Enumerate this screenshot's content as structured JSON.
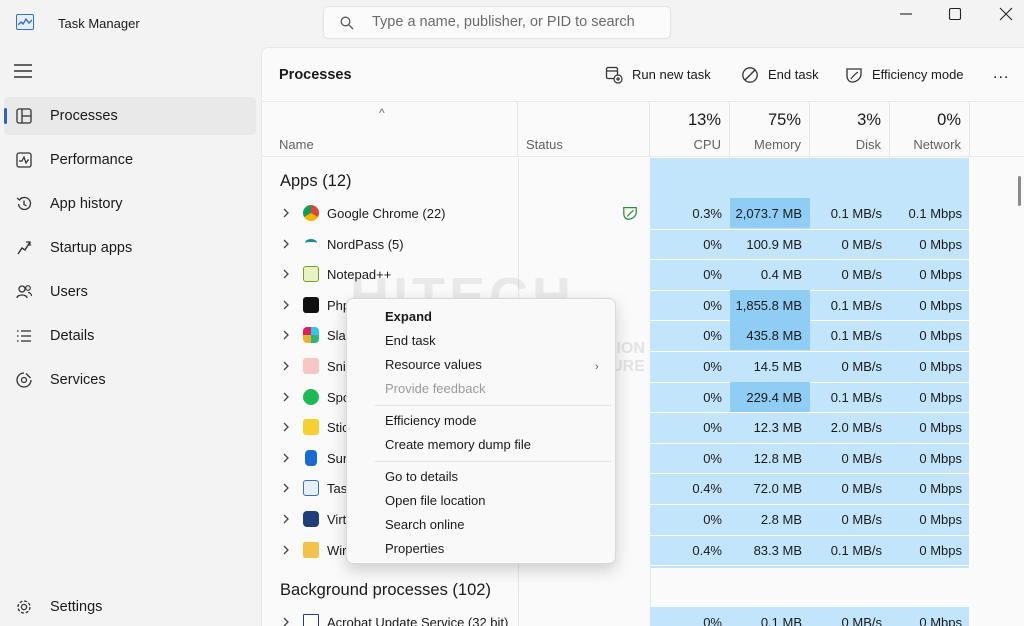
{
  "window": {
    "title": "Task Manager",
    "search_placeholder": "Type a name, publisher, or PID to search"
  },
  "sidebar": {
    "items": [
      {
        "label": "Processes",
        "icon": "processes-icon"
      },
      {
        "label": "Performance",
        "icon": "performance-icon"
      },
      {
        "label": "App history",
        "icon": "history-icon"
      },
      {
        "label": "Startup apps",
        "icon": "startup-icon"
      },
      {
        "label": "Users",
        "icon": "users-icon"
      },
      {
        "label": "Details",
        "icon": "details-icon"
      },
      {
        "label": "Services",
        "icon": "services-icon"
      }
    ],
    "settings_label": "Settings"
  },
  "toolbar": {
    "title": "Processes",
    "run_new_task": "Run new task",
    "end_task": "End task",
    "efficiency_mode": "Efficiency mode",
    "more": "..."
  },
  "table": {
    "columns": {
      "name": "Name",
      "status": "Status",
      "cpu_pct": "13%",
      "cpu": "CPU",
      "memory_pct": "75%",
      "memory": "Memory",
      "disk_pct": "3%",
      "disk": "Disk",
      "network_pct": "0%",
      "network": "Network"
    },
    "apps_header": "Apps (12)",
    "background_header": "Background processes (102)",
    "apps": [
      {
        "name": "Google Chrome (22)",
        "cpu": "0.3%",
        "memory": "2,073.7 MB",
        "disk": "0.1 MB/s",
        "network": "0.1 Mbps"
      },
      {
        "name": "NordPass (5)",
        "cpu": "0%",
        "memory": "100.9 MB",
        "disk": "0 MB/s",
        "network": "0 Mbps"
      },
      {
        "name": "Notepad++",
        "cpu": "0%",
        "memory": "0.4 MB",
        "disk": "0 MB/s",
        "network": "0 Mbps"
      },
      {
        "name": "Php",
        "cpu": "0%",
        "memory": "1,855.8 MB",
        "disk": "0.1 MB/s",
        "network": "0 Mbps"
      },
      {
        "name": "Sla",
        "cpu": "0%",
        "memory": "435.8 MB",
        "disk": "0.1 MB/s",
        "network": "0 Mbps"
      },
      {
        "name": "Sni",
        "cpu": "0%",
        "memory": "14.5 MB",
        "disk": "0 MB/s",
        "network": "0 Mbps"
      },
      {
        "name": "Spo",
        "cpu": "0%",
        "memory": "229.4 MB",
        "disk": "0.1 MB/s",
        "network": "0 Mbps"
      },
      {
        "name": "Stic",
        "cpu": "0%",
        "memory": "12.3 MB",
        "disk": "2.0 MB/s",
        "network": "0 Mbps"
      },
      {
        "name": "Sur",
        "cpu": "0%",
        "memory": "12.8 MB",
        "disk": "0 MB/s",
        "network": "0 Mbps"
      },
      {
        "name": "Tas",
        "cpu": "0.4%",
        "memory": "72.0 MB",
        "disk": "0 MB/s",
        "network": "0 Mbps"
      },
      {
        "name": "Virt",
        "cpu": "0%",
        "memory": "2.8 MB",
        "disk": "0 MB/s",
        "network": "0 Mbps"
      },
      {
        "name": "Wir",
        "cpu": "0.4%",
        "memory": "83.3 MB",
        "disk": "0.1 MB/s",
        "network": "0 Mbps"
      }
    ],
    "background": [
      {
        "name": "Acrobat Update Service (32 bit)",
        "cpu": "0%",
        "memory": "0.1 MB",
        "disk": "0 MB/s",
        "network": "0 Mbps"
      }
    ]
  },
  "context_menu": {
    "items": [
      "Expand",
      "End task",
      "Resource values",
      "Provide feedback",
      "Efficiency mode",
      "Create memory dump file",
      "Go to details",
      "Open file location",
      "Search online",
      "Properties"
    ]
  },
  "watermark": {
    "main": "HITECH",
    "sub": "WORK",
    "tagline1": "YOUR VISION",
    "tagline2": "OUR FUTURE"
  },
  "colors": {
    "accent": "#2b63c9",
    "column_highlight": "#c2e5fb",
    "memory_highlight": "#8fcdf5"
  }
}
